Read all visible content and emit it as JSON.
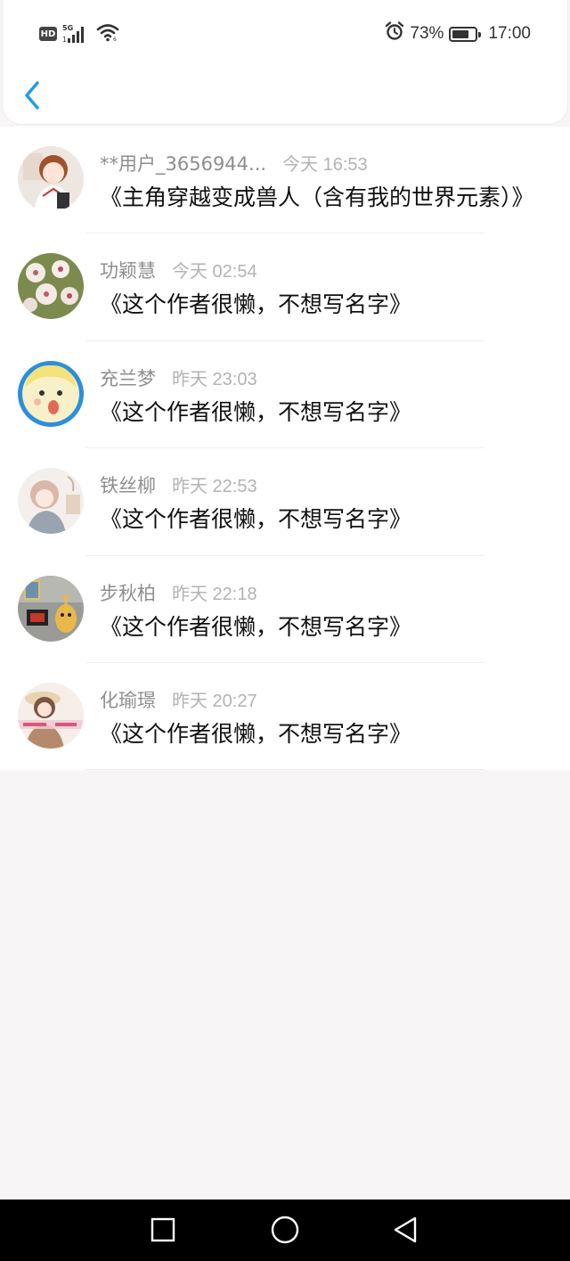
{
  "status_bar": {
    "hd": "HD",
    "network": "5G",
    "battery_percent": "73%",
    "battery_level": 0.73,
    "time": "17:00"
  },
  "icons": {
    "back": "chevron-left-icon",
    "alarm": "alarm-icon",
    "wifi": "wifi-icon",
    "signal": "signal-icon"
  },
  "colors": {
    "accent": "#1e9be8",
    "name_gray": "#8e8e8e",
    "time_gray": "#b3b3b3",
    "title_text": "#111111"
  },
  "items": [
    {
      "user": "**用户_3656944...",
      "time": "今天 16:53",
      "title": "《主角穿越变成兽人（含有我的世界元素）》"
    },
    {
      "user": "功颖慧",
      "time": "今天 02:54",
      "title": "《这个作者很懒，不想写名字》"
    },
    {
      "user": "充兰梦",
      "time": "昨天 23:03",
      "title": "《这个作者很懒，不想写名字》"
    },
    {
      "user": "铁丝柳",
      "time": "昨天 22:53",
      "title": "《这个作者很懒，不想写名字》"
    },
    {
      "user": "步秋柏",
      "time": "昨天 22:18",
      "title": "《这个作者很懒，不想写名字》"
    },
    {
      "user": "化瑜璟",
      "time": "昨天 20:27",
      "title": "《这个作者很懒，不想写名字》"
    }
  ],
  "nav": [
    "recents-button",
    "home-button",
    "back-nav-button"
  ]
}
